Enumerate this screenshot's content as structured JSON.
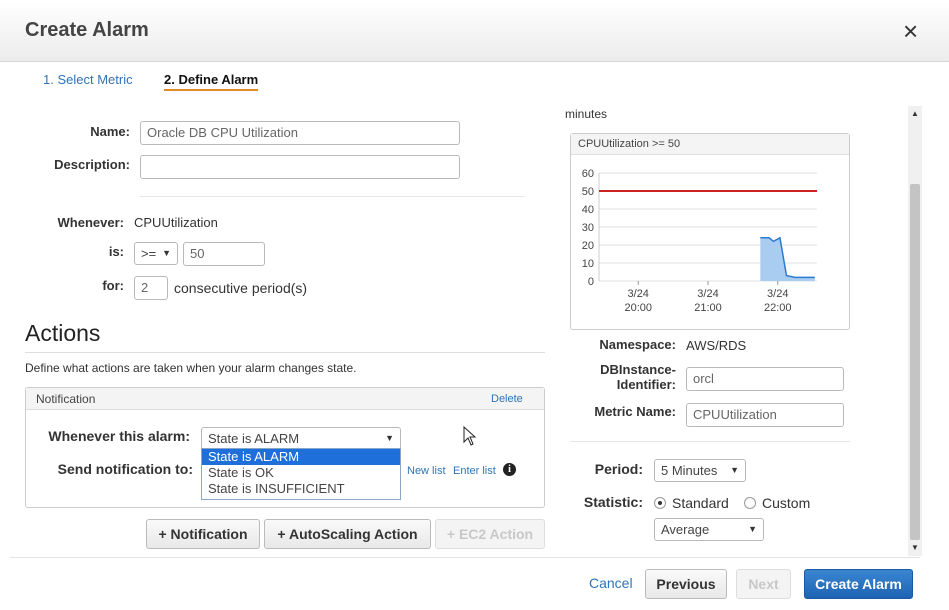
{
  "dialog": {
    "title": "Create Alarm",
    "close": "×"
  },
  "steps": [
    {
      "label": "1. Select Metric"
    },
    {
      "label": "2. Define Alarm"
    }
  ],
  "form": {
    "name_label": "Name:",
    "name_value": "Oracle DB CPU Utilization",
    "description_label": "Description:",
    "description_value": "",
    "whenever_label": "Whenever:",
    "whenever_value": "CPUUtilization",
    "is_label": "is:",
    "operator": "&gt;=",
    "threshold": "50",
    "for_label": "for:",
    "periods": "2",
    "periods_suffix": "consecutive period(s)"
  },
  "actions": {
    "title": "Actions",
    "description": "Define what actions are taken when your alarm changes state.",
    "notification": {
      "header": "Notification",
      "delete": "Delete",
      "whenever_label": "Whenever this alarm:",
      "selected": "State is ALARM",
      "options": [
        "State is ALARM",
        "State is OK",
        "State is INSUFFICIENT"
      ],
      "send_label": "Send notification to:",
      "new_list": "New list",
      "enter_list": "Enter list",
      "info": "i"
    },
    "buttons": {
      "notification": "+ Notification",
      "autoscaling": "+ AutoScaling Action",
      "ec2": "+ EC2 Action"
    }
  },
  "preview": {
    "top_text": "minutes",
    "graph_title": "CPUUtilization >= 50",
    "namespace_label": "Namespace:",
    "namespace_value": "AWS/RDS",
    "dbinstance_label_1": "DBInstance-",
    "dbinstance_label_2": "Identifier:",
    "dbinstance_value": "orcl",
    "metric_label": "Metric Name:",
    "metric_value": "CPUUtilization",
    "period_label": "Period:",
    "period_value": "5 Minutes",
    "statistic_label": "Statistic:",
    "standard": "Standard",
    "custom": "Custom",
    "statistic_value": "Average"
  },
  "chart_data": {
    "type": "area",
    "title": "CPUUtilization >= 50",
    "ylim": [
      0,
      60
    ],
    "yticks": [
      0,
      10,
      20,
      30,
      40,
      50,
      60
    ],
    "xticks": [
      {
        "line1": "3/24",
        "line2": "20:00",
        "pos": 0.18
      },
      {
        "line1": "3/24",
        "line2": "21:00",
        "pos": 0.5
      },
      {
        "line1": "3/24",
        "line2": "22:00",
        "pos": 0.82
      }
    ],
    "threshold": 50,
    "threshold_color": "#cc2222",
    "series": [
      {
        "x": [
          0.74,
          0.78,
          0.8,
          0.83,
          0.86,
          0.9,
          0.95,
          0.99
        ],
        "values": [
          24,
          24,
          22,
          24,
          3,
          2,
          2,
          2
        ]
      }
    ],
    "fill_color": "#a9cdf0",
    "line_color": "#2a7ad0"
  },
  "footer": {
    "cancel": "Cancel",
    "previous": "Previous",
    "next": "Next",
    "create": "Create Alarm"
  }
}
